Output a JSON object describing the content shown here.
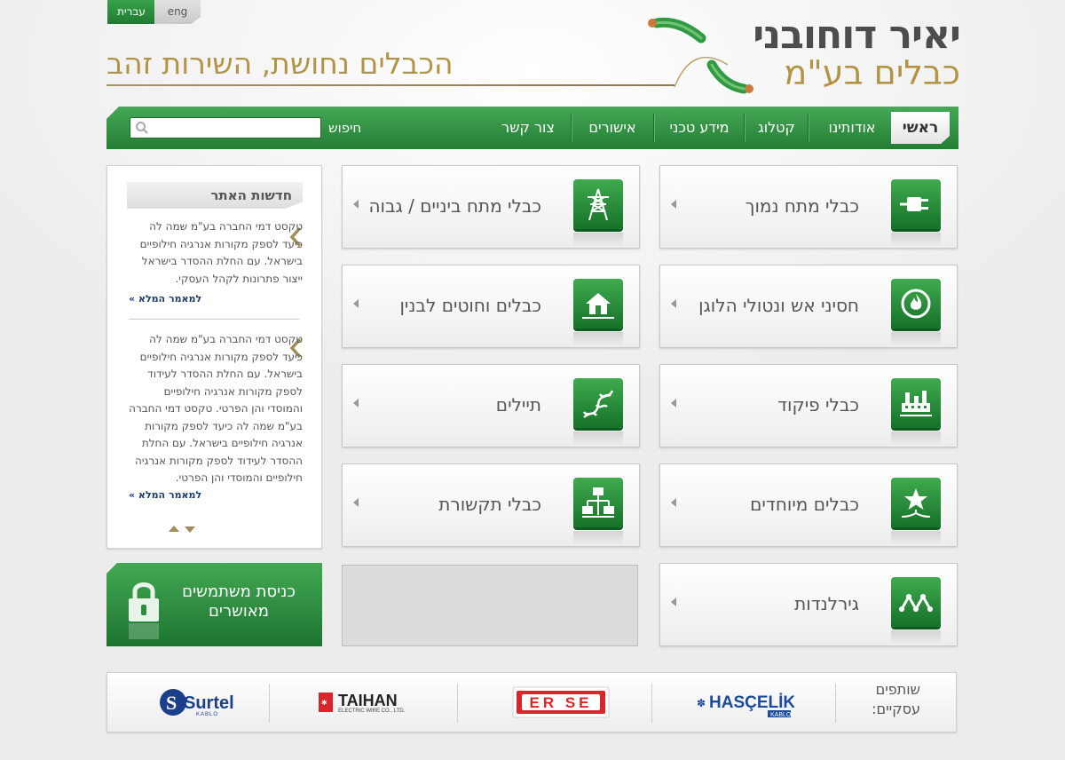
{
  "lang": {
    "hebrew": "עברית",
    "english": "eng"
  },
  "logo": {
    "name": "יאיר דוחובני",
    "sub": "כבלים בע\"מ"
  },
  "tagline": "הכבלים נחושת, השירות זהב",
  "nav": {
    "items": [
      "ראשי",
      "אודותינו",
      "קטלוג",
      "מידע טכני",
      "אישורים",
      "צור קשר"
    ],
    "search_label": "חיפוש",
    "search_value": ""
  },
  "products": [
    {
      "title": "כבלי מתח נמוך",
      "icon": "plug-icon"
    },
    {
      "title": "כבלי מתח ביניים / גבוה",
      "icon": "power-tower-icon"
    },
    {
      "title": "חסיני אש ונטולי הלוגן",
      "icon": "fire-icon"
    },
    {
      "title": "כבלים וחוטים לבנין",
      "icon": "house-icon"
    },
    {
      "title": "כבלי פיקוד",
      "icon": "control-panel-icon"
    },
    {
      "title": "תיילים",
      "icon": "wire-twist-icon"
    },
    {
      "title": "כבלים מיוחדים",
      "icon": "star-icon"
    },
    {
      "title": "כבלי תקשורת",
      "icon": "network-icon"
    },
    {
      "title": "גירלנדות",
      "icon": "garland-icon"
    }
  ],
  "news": {
    "title": "חדשות האתר",
    "items": [
      {
        "text": "טקסט דמי החברה בע\"מ שמה לה כיעד לספק מקורות אנרגיה חילופיים בישראל. עם החלת ההסדר בישראל ייצור פתרונות לקהל העסקי.",
        "more": "למאמר המלא »"
      },
      {
        "text": "טקסט דמי החברה בע\"מ שמה לה כיעד לספק מקורות אנרגיה חילופיים בישראל. עם החלת ההסדר לעידוד לספק מקורות אנרגיה חילופיים והמוסדי והן הפרטי. טקסט דמי החברה בע\"מ שמה לה כיעד לספק מקורות אנרגיה חילופיים בישראל. עם החלת ההסדר לעידוד לספק מקורות אנרגיה חילופיים והמוסדי והן הפרטי.",
        "more": "למאמר המלא »"
      }
    ]
  },
  "login": {
    "label": "כניסת משתמשים מאושרים"
  },
  "partners": {
    "title": "שותפים עסקיים:",
    "logos": [
      {
        "name": "HASÇELİK",
        "sub": "KABLO"
      },
      {
        "name": "ER SE"
      },
      {
        "name": "TAIHAN",
        "sub": "ELECTRIC WIRE CO., LTD."
      },
      {
        "name": "Surtel",
        "sub": "KABLO"
      }
    ]
  }
}
